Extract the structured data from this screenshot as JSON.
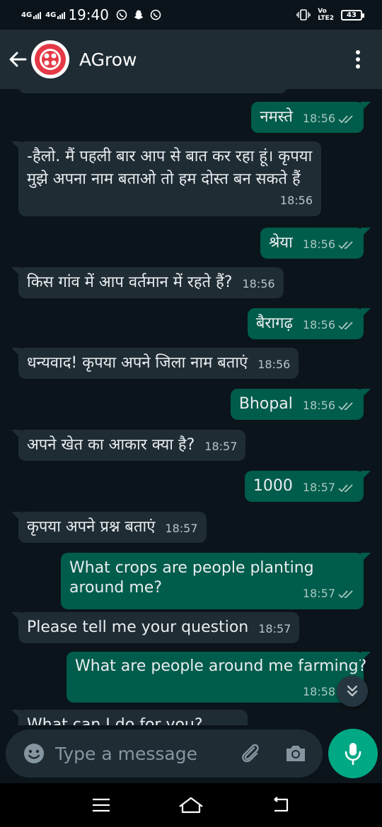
{
  "status_bar": {
    "network1": "4G",
    "network2": "4G",
    "time": "19:40",
    "volte": "Vo",
    "lte": "LTE2",
    "battery": "43"
  },
  "header": {
    "title": "AGrow"
  },
  "messages": [
    {
      "dir": "out",
      "text": "नमस्ते",
      "time": "18:56"
    },
    {
      "dir": "in",
      "text": "-हैलो. मैं पहली बार आप से बात कर रहा हूं। कृपया मुझे अपना नाम बताओ तो हम दोस्त बन सकते हैं",
      "time": "18:56"
    },
    {
      "dir": "out",
      "text": "श्रेया",
      "time": "18:56"
    },
    {
      "dir": "in",
      "text": "किस गांव में आप वर्तमान में रहते हैं?",
      "time": "18:56"
    },
    {
      "dir": "out",
      "text": "बैरागढ़",
      "time": "18:56"
    },
    {
      "dir": "in",
      "text": "धन्यवाद! कृपया अपने जिला नाम बताएं",
      "time": "18:56"
    },
    {
      "dir": "out",
      "text": "Bhopal",
      "time": "18:56"
    },
    {
      "dir": "in",
      "text": "अपने खेत का आकार क्या है?",
      "time": "18:57"
    },
    {
      "dir": "out",
      "text": "1000",
      "time": "18:57"
    },
    {
      "dir": "in",
      "text": "कृपया अपने प्रश्न बताएं",
      "time": "18:57"
    },
    {
      "dir": "out",
      "text": "What crops are people planting around me?",
      "time": "18:57"
    },
    {
      "dir": "in",
      "text": "Please tell me your question",
      "time": "18:57"
    },
    {
      "dir": "out",
      "text": "What are people around me farming?",
      "time": "18:58"
    },
    {
      "dir": "in",
      "text": "What can I do for you?",
      "time": ""
    }
  ],
  "input": {
    "placeholder": "Type a message",
    "value": ""
  },
  "colors": {
    "background": "#0b141a",
    "header": "#1f2c34",
    "incoming_bubble": "#1f2c34",
    "outgoing_bubble": "#005c4b",
    "accent": "#00a884",
    "avatar_brand": "#e63946"
  },
  "icons": {
    "back": "arrow-left-icon",
    "menu": "more-vert-icon",
    "emoji": "emoji-icon",
    "attach": "paperclip-icon",
    "camera": "camera-icon",
    "mic": "mic-icon",
    "scroll_down": "double-chevron-down-icon",
    "read_receipt": "double-check-icon"
  }
}
